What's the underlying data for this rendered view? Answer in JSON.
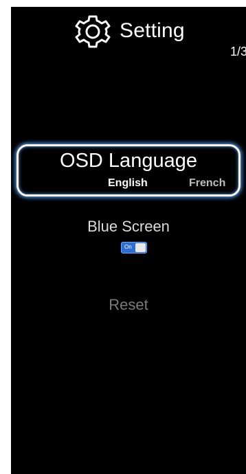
{
  "header": {
    "title": "Setting",
    "icon": "gear-icon",
    "page_indicator": "1/3"
  },
  "menu": {
    "osd_language": {
      "label": "OSD Language",
      "selected_option": "English",
      "other_option": "French"
    },
    "blue_screen": {
      "label": "Blue Screen",
      "toggle_text": "On",
      "toggle_state": "on"
    },
    "reset": {
      "label": "Reset"
    }
  },
  "colors": {
    "background": "#000000",
    "highlight_border": "#ffffff",
    "highlight_glow": "#5aa0ff",
    "toggle_on": "#2b6fd6",
    "disabled_text": "#7a7a7a"
  }
}
